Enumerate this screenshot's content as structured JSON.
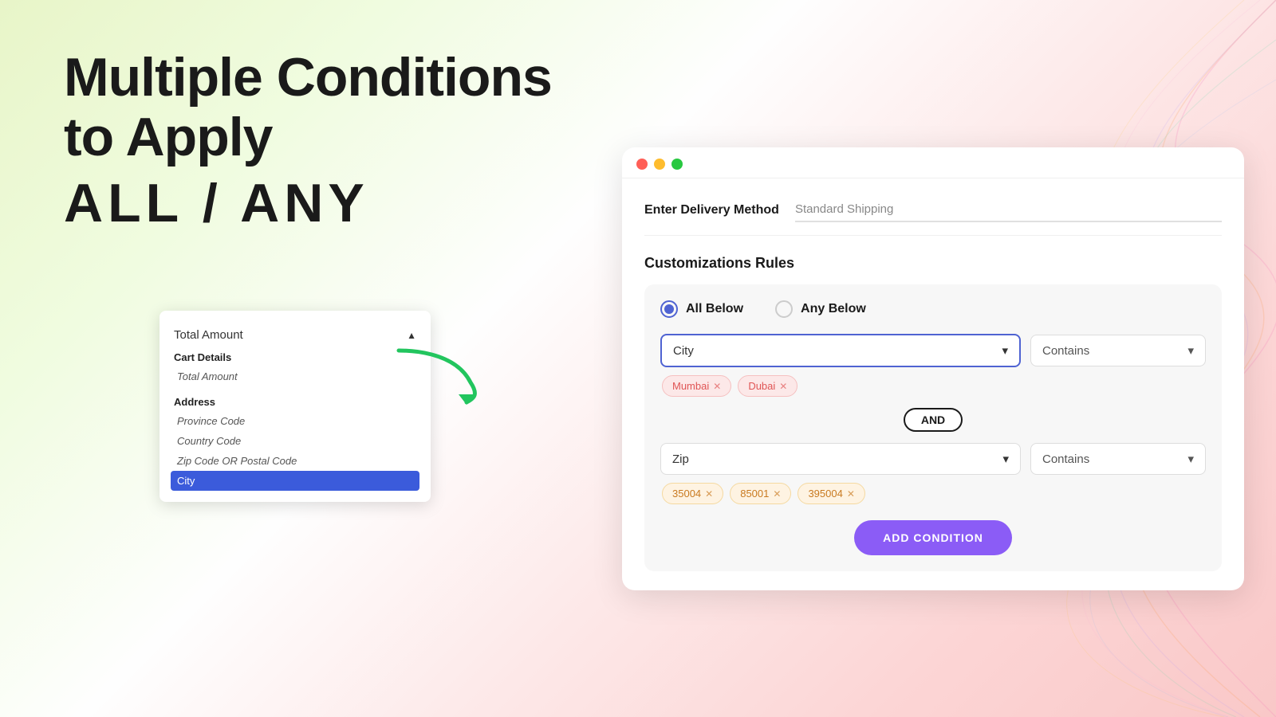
{
  "background": {
    "colors": [
      "#e8f5c8",
      "#fefefe",
      "#fcd5d5"
    ]
  },
  "left": {
    "title_line1": "Multiple Conditions",
    "title_line2": "to Apply",
    "subtitle": "ALL / ANY"
  },
  "dropdown": {
    "trigger_label": "Total Amount",
    "trigger_arrow": "▲",
    "sections": [
      {
        "title": "Cart Details",
        "items": [
          {
            "label": "Total Amount",
            "active": false
          }
        ]
      },
      {
        "title": "Address",
        "items": [
          {
            "label": "Province Code",
            "active": false
          },
          {
            "label": "Country Code",
            "active": false
          },
          {
            "label": "Zip Code OR Postal Code",
            "active": false
          },
          {
            "label": "City",
            "active": true
          }
        ]
      }
    ]
  },
  "window": {
    "dots": [
      "red",
      "yellow",
      "green"
    ],
    "delivery": {
      "label": "Enter Delivery Method",
      "placeholder": "Standard Shipping"
    },
    "customizations_title": "Customizations Rules",
    "toggle": {
      "option1": "All Below",
      "option2": "Any Below",
      "selected": "all"
    },
    "conditions": [
      {
        "field": "City",
        "operator": "Contains",
        "tags": [
          {
            "label": "Mumbai",
            "style": "pink"
          },
          {
            "label": "Dubai",
            "style": "pink"
          }
        ]
      },
      {
        "field": "Zip",
        "operator": "Contains",
        "tags": [
          {
            "label": "35004",
            "style": "orange"
          },
          {
            "label": "85001",
            "style": "orange"
          },
          {
            "label": "395004",
            "style": "orange"
          }
        ]
      }
    ],
    "and_label": "AND",
    "add_condition_label": "ADD CONDITION"
  }
}
